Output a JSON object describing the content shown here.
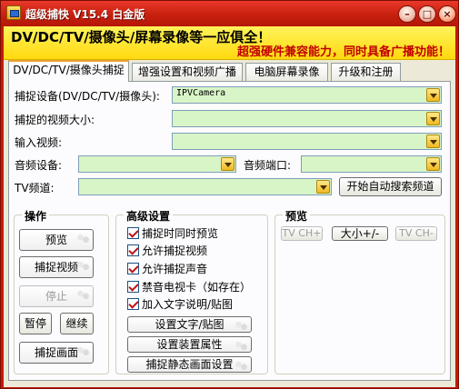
{
  "window": {
    "title": "超级捕快 V15.4 白金版",
    "controls": {
      "minimize": "–",
      "maximize": "□",
      "close": "×"
    }
  },
  "banner": {
    "line1": "DV/DC/TV/摄像头/屏幕录像等一应俱全！",
    "line2": "超强硬件兼容能力，同时具备广播功能！"
  },
  "tabs": [
    {
      "label": "DV/DC/TV/摄像头捕捉",
      "active": true
    },
    {
      "label": "增强设置和视频广播",
      "active": false
    },
    {
      "label": "电脑屏幕录像",
      "active": false
    },
    {
      "label": "升级和注册",
      "active": false
    }
  ],
  "form": {
    "device_label": "捕捉设备(DV/DC/TV/摄像头):",
    "device_value": "IPVCamera",
    "size_label": "捕捉的视频大小:",
    "size_value": "",
    "input_label": "输入视频:",
    "input_value": "",
    "audio_label": "音频设备:",
    "audio_value": "",
    "audio_port_label": "音频端口:",
    "audio_port_value": "",
    "tv_label": "TV频道:",
    "tv_value": "",
    "tv_search_button": "开始自动搜索频道"
  },
  "operations": {
    "title": "操作",
    "preview": "预览",
    "capture_video": "捕捉视频",
    "stop": "停止",
    "pause": "暂停",
    "resume": "继续",
    "capture_frame": "捕捉画面"
  },
  "advanced": {
    "title": "高级设置",
    "checkboxes": [
      {
        "label": "捕捉时同时预览",
        "checked": true
      },
      {
        "label": "允许捕捉视频",
        "checked": true
      },
      {
        "label": "允许捕捉声音",
        "checked": true
      },
      {
        "label": "禁音电视卡（如存在）",
        "checked": true
      },
      {
        "label": "加入文字说明/贴图",
        "checked": true
      }
    ],
    "buttons": {
      "text_overlay": "设置文字/贴图",
      "device_props": "设置装置属性",
      "still_settings": "捕捉静态画面设置"
    }
  },
  "preview_group": {
    "title": "预览",
    "tv_ch_up": "TV CH+",
    "size": "大小+/-",
    "tv_ch_down": "TV CH-"
  },
  "colors": {
    "titlebar": "#c8200f",
    "banner": "#ffe020",
    "combo_fill": "#d8f5c8",
    "tab_active_accent": "#f0a030"
  }
}
